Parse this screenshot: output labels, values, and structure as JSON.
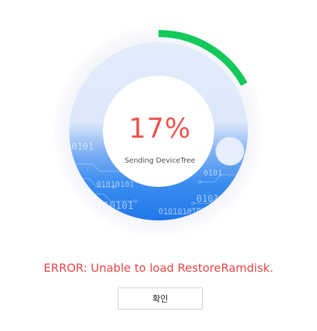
{
  "progress": {
    "percent_label": "17%",
    "value": 0.17,
    "status_text": "Sending DeviceTree",
    "accent_color": "#12c95a",
    "fill_color": "#2b83f0"
  },
  "error": {
    "message": "ERROR: Unable to load RestoreRamdisk.",
    "color": "#e64545"
  },
  "confirm_button": {
    "label": "확인"
  },
  "decorations": {
    "binary_strings": [
      "0101",
      "01010101",
      "01010",
      "1010101",
      "01010101010",
      "0101"
    ]
  }
}
